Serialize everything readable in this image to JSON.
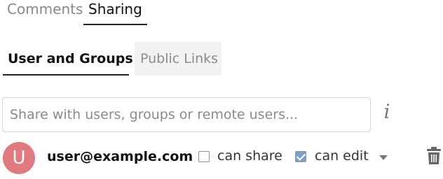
{
  "top_tabs": {
    "comments_label": "Comments",
    "sharing_label": "Sharing",
    "active": "Sharing"
  },
  "sub_tabs": {
    "users_label": "User and Groups",
    "public_label": "Public Links",
    "active": "User and Groups"
  },
  "share": {
    "placeholder": "Share with users, groups or remote users...",
    "value": "",
    "info_icon": "info-icon",
    "info_glyph": "i"
  },
  "shares": [
    {
      "avatar_letter": "U",
      "avatar_color": "#e07a7f",
      "user": "user@example.com",
      "can_share_label": "can share",
      "can_share_checked": false,
      "can_edit_label": "can edit",
      "can_edit_checked": true,
      "menu_icon": "caret-down-icon",
      "delete_icon": "trash-icon"
    }
  ],
  "colors": {
    "accent": "#7f9fc2",
    "inactive_tab_bg": "#f2f2f2",
    "inactive_text": "#8a8a8a"
  }
}
